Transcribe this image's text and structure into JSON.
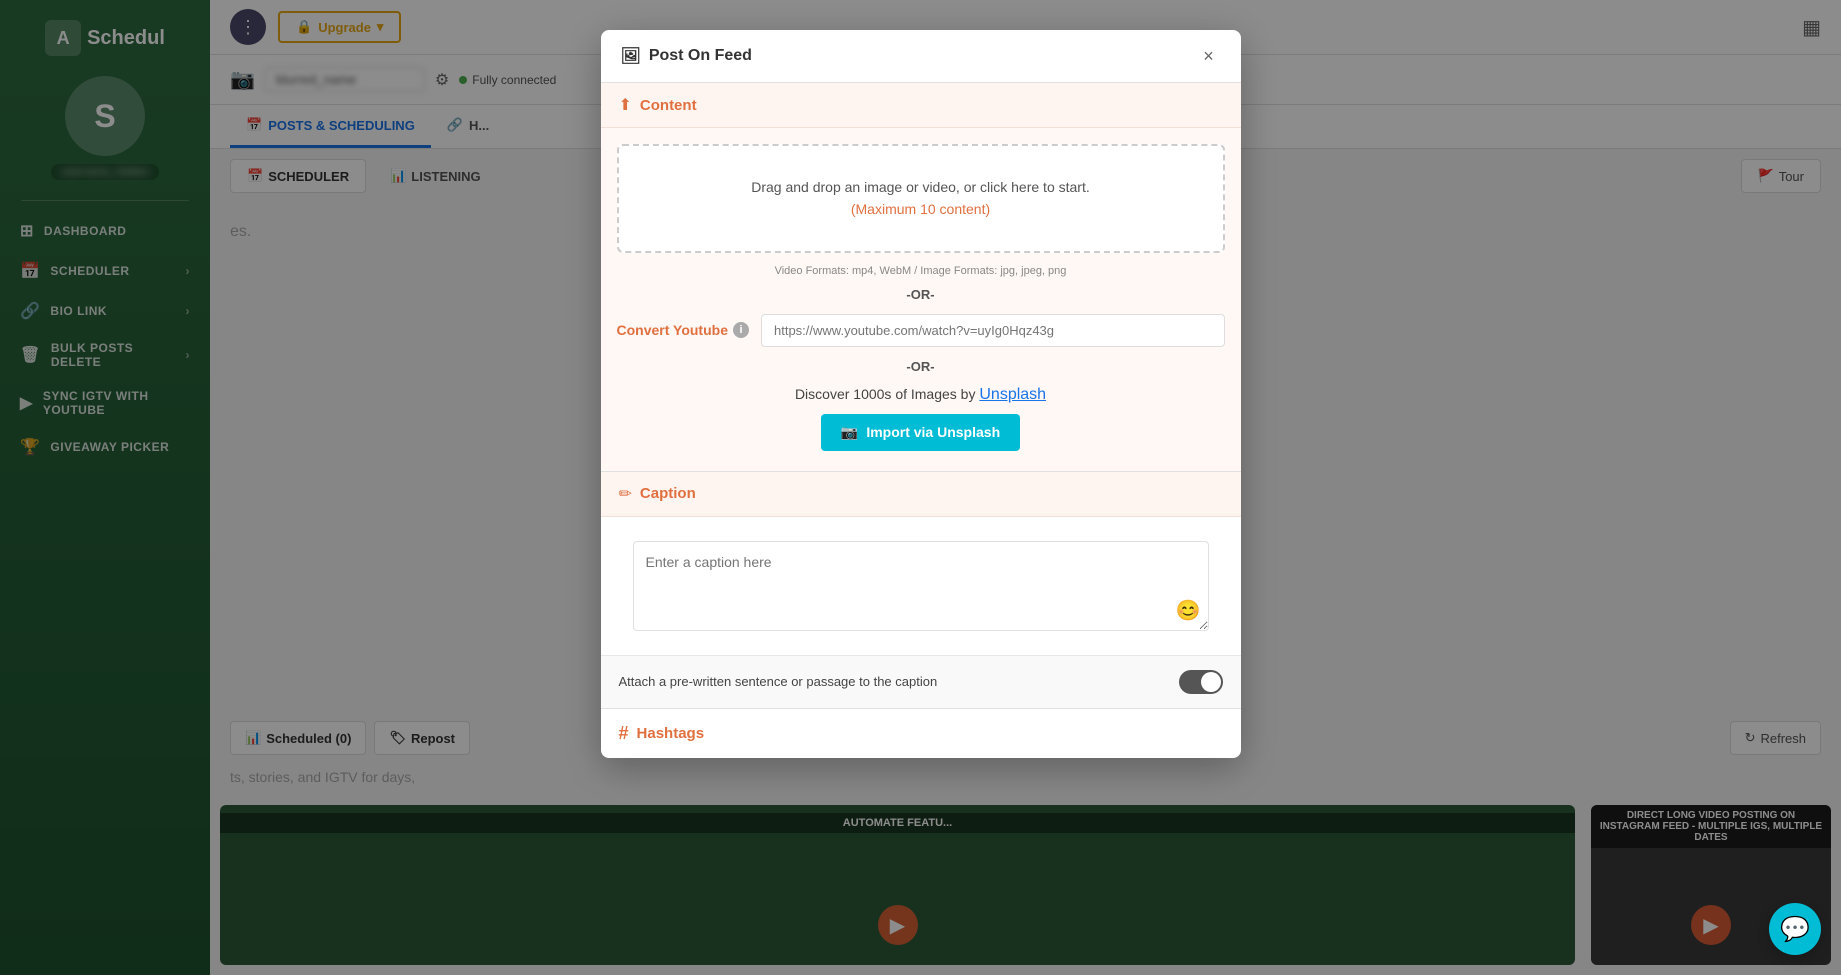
{
  "app": {
    "name": "Schedul",
    "logo_symbol": "A"
  },
  "sidebar": {
    "avatar_letter": "S",
    "username_placeholder": "username",
    "items": [
      {
        "id": "dashboard",
        "label": "DASHBOARD",
        "icon": "⊞"
      },
      {
        "id": "scheduler",
        "label": "SCHEDULER",
        "icon": "📅"
      },
      {
        "id": "bio-link",
        "label": "BIO LINK",
        "icon": "🔗"
      },
      {
        "id": "bulk-posts",
        "label": "BULK POSTS DELETE",
        "icon": "🗑"
      },
      {
        "id": "sync-igtv",
        "label": "SYNC IGTV WITH YOUTUBE",
        "icon": "▶"
      },
      {
        "id": "giveaway",
        "label": "GIVEAWAY PICKER",
        "icon": "🏆"
      }
    ]
  },
  "topbar": {
    "upgrade_label": "Upgrade",
    "upgrade_icon": "🔒"
  },
  "ig_bar": {
    "connected_text": "Fully connected"
  },
  "nav_tabs": {
    "tabs": [
      {
        "id": "posts",
        "label": "POSTS & SCHEDULING",
        "icon": "📅",
        "active": true
      },
      {
        "id": "hashtags",
        "label": "H",
        "icon": "🔗",
        "active": false
      }
    ]
  },
  "scheduler_tabs": {
    "tabs": [
      {
        "id": "scheduler",
        "label": "SCHEDULER",
        "icon": "📅",
        "active": true
      },
      {
        "id": "listening",
        "label": "LISTENING",
        "icon": "📊",
        "active": false
      }
    ],
    "tour_button": "Tour"
  },
  "bottom_tabs": {
    "tabs": [
      {
        "id": "scheduled",
        "label": "Scheduled (0)",
        "icon": "📊"
      },
      {
        "id": "repost",
        "label": "Repost",
        "icon": "🏷"
      }
    ],
    "refresh_button": "Refresh"
  },
  "modal": {
    "title": "Post On Feed",
    "title_icon": "🖼",
    "close_icon": "×",
    "sections": {
      "content": {
        "label": "Content",
        "icon": "⬆",
        "dropzone": {
          "main_text": "Drag and drop an image or video, or click here to start.",
          "limit_text": "(Maximum 10 content)"
        },
        "format_text": "Video Formats: mp4, WebM / Image Formats: jpg, jpeg, png",
        "or_text_1": "-OR-",
        "convert_youtube": {
          "label": "Convert Youtube",
          "placeholder": "https://www.youtube.com/watch?v=uyIg0Hqz43g",
          "info": "ℹ"
        },
        "or_text_2": "-OR-",
        "unsplash": {
          "text": "Discover 1000s of Images by ",
          "link_text": "Unsplash"
        },
        "import_btn": "Import via Unsplash",
        "camera_icon": "📷"
      },
      "caption": {
        "label": "Caption",
        "icon": "✏",
        "placeholder": "Enter a caption here",
        "emoji_icon": "😊",
        "attach": {
          "label": "Attach a pre-written sentence or passage to the caption",
          "toggle_on": true
        }
      },
      "hashtags": {
        "label": "Hashtags",
        "icon": "#"
      }
    }
  },
  "tour_text": "Tour",
  "chat_icon": "💬",
  "bg_text": "es.",
  "bg_caption_text": "ts, stories, and IGTV for days,",
  "feature_cards": [
    {
      "title": "AUTOMATE FEATU..."
    },
    {
      "title": "DIRECT LONG VIDEO POSTING ON INSTAGRAM FEED - MULTIPLE IGS, MULTIPLE DATES"
    }
  ]
}
